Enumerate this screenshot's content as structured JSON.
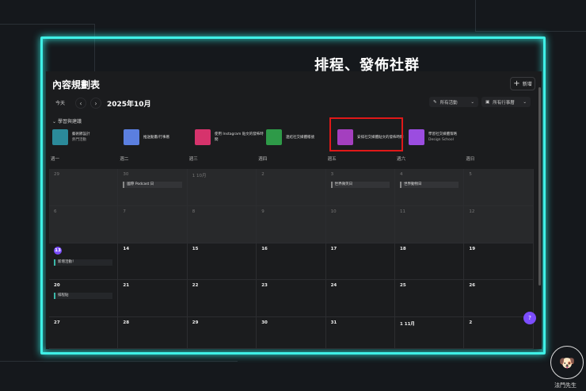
{
  "annotation": "排程、發佈社群",
  "header": {
    "title": "內容規劃表",
    "new_label": "新增",
    "today_label": "今天",
    "prev": "‹",
    "next": "›",
    "month": "2025年10月"
  },
  "filters": [
    {
      "icon": "edit-icon",
      "label": "所有活動"
    },
    {
      "icon": "calendar-icon",
      "label": "所有行事曆"
    }
  ],
  "group": {
    "label": "學習與建議"
  },
  "suggestions": [
    {
      "title": "藝術節設計",
      "subtitle": "熱門活動",
      "color": "#2b8a9a"
    },
    {
      "title": "推送動畫/行事曆",
      "subtitle": "",
      "color": "#5b7fe0"
    },
    {
      "title": "使用 Instagram 貼文的發佈時間",
      "subtitle": "",
      "color": "#d6336c"
    },
    {
      "title": "連結社交媒體帳號",
      "subtitle": "",
      "color": "#2e9a48"
    },
    {
      "title": "安排社交媒體貼文的發佈時間",
      "subtitle": "",
      "color": "#a43fbf"
    },
    {
      "title": "學習社交媒體策略",
      "subtitle": "Design School",
      "color": "#9b4de0"
    }
  ],
  "weekdays": [
    "週一",
    "週二",
    "週三",
    "週四",
    "週五",
    "週六",
    "週日"
  ],
  "weeks": [
    [
      {
        "d": "29"
      },
      {
        "d": "30",
        "ev": "國際 Podcast 日"
      },
      {
        "d": "1  10月"
      },
      {
        "d": "2"
      },
      {
        "d": "3",
        "ev": "世界微笑日"
      },
      {
        "d": "4",
        "ev": "世界動物日"
      },
      {
        "d": "5"
      }
    ],
    [
      {
        "d": "6"
      },
      {
        "d": "7"
      },
      {
        "d": "8"
      },
      {
        "d": "9"
      },
      {
        "d": "10"
      },
      {
        "d": "11"
      },
      {
        "d": "12"
      }
    ],
    [
      {
        "d": "13",
        "today": true,
        "ev": "新增活動！"
      },
      {
        "d": "14"
      },
      {
        "d": "15"
      },
      {
        "d": "16"
      },
      {
        "d": "17"
      },
      {
        "d": "18"
      },
      {
        "d": "19"
      }
    ],
    [
      {
        "d": "20",
        "ev": "排程貼"
      },
      {
        "d": "21"
      },
      {
        "d": "22"
      },
      {
        "d": "23"
      },
      {
        "d": "24"
      },
      {
        "d": "25"
      },
      {
        "d": "26"
      }
    ],
    [
      {
        "d": "27"
      },
      {
        "d": "28"
      },
      {
        "d": "29"
      },
      {
        "d": "30"
      },
      {
        "d": "31"
      },
      {
        "d": "1  11月"
      },
      {
        "d": "2"
      }
    ]
  ],
  "help_label": "?",
  "logo_text": "法門先生"
}
